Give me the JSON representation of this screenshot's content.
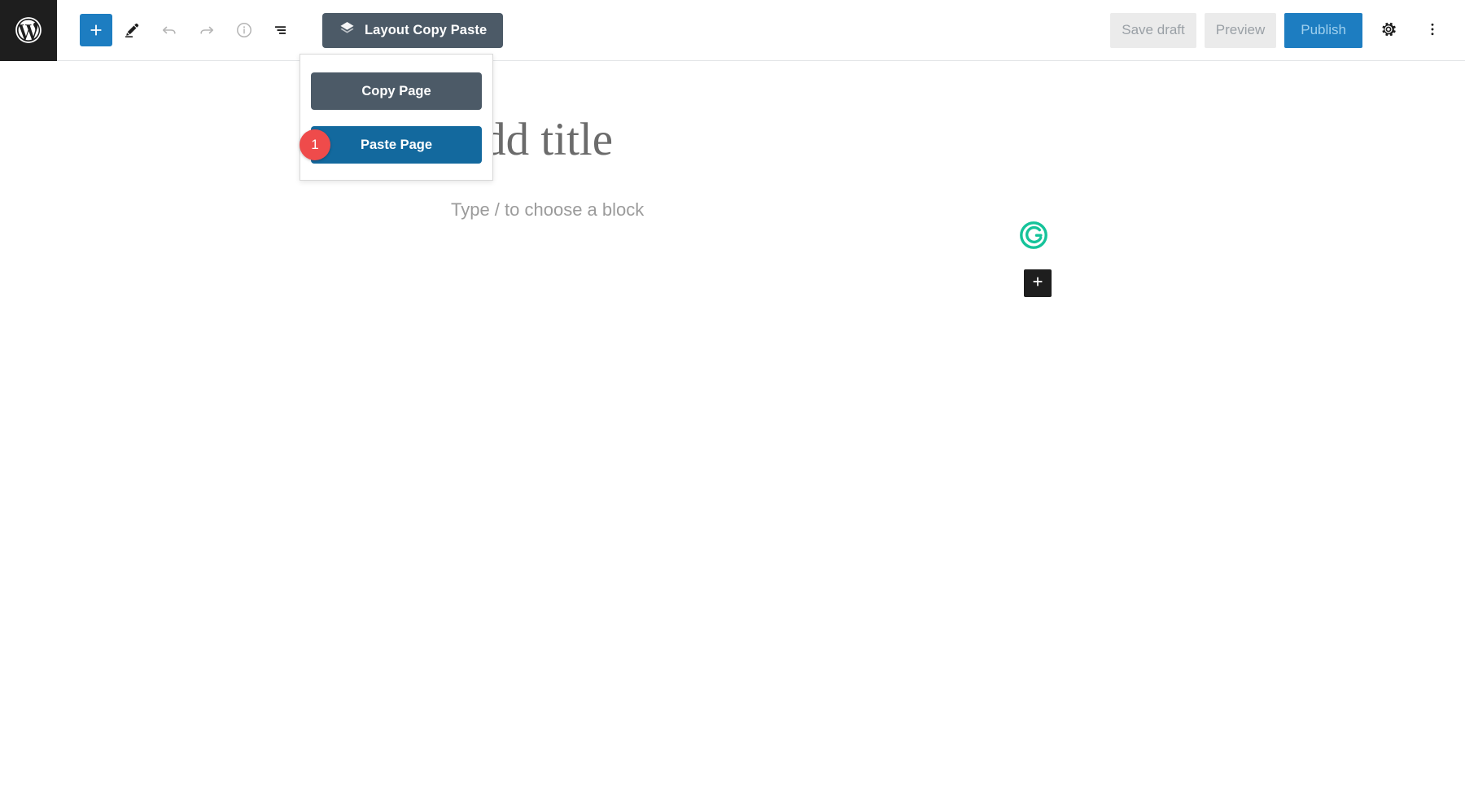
{
  "header": {
    "logo_icon": "wordpress-logo-icon",
    "tools": [
      {
        "name": "add-block-button",
        "icon": "plus-icon",
        "label": "Add block",
        "state": "active"
      },
      {
        "name": "tools-button",
        "icon": "pencil-icon",
        "label": "Tools",
        "state": "enabled"
      },
      {
        "name": "undo-button",
        "icon": "undo-arrow-icon",
        "label": "Undo",
        "state": "disabled"
      },
      {
        "name": "redo-button",
        "icon": "redo-arrow-icon",
        "label": "Redo",
        "state": "disabled"
      },
      {
        "name": "details-button",
        "icon": "info-circle-icon",
        "label": "Details",
        "state": "disabled"
      },
      {
        "name": "list-view-button",
        "icon": "list-view-icon",
        "label": "List view",
        "state": "enabled"
      }
    ],
    "plugin_button": {
      "label": "Layout Copy Paste",
      "icon": "layers-diamond-icon"
    },
    "actions": {
      "save_draft_label": "Save draft",
      "preview_label": "Preview",
      "publish_label": "Publish",
      "settings_icon": "gear-icon",
      "more_options_icon": "three-dots-vertical-icon"
    }
  },
  "dropdown": {
    "visible": true,
    "copy_label": "Copy Page",
    "paste_label": "Paste Page",
    "paste_badge_count": "1"
  },
  "editor": {
    "title_placeholder": "Add title",
    "block_placeholder": "Type / to choose a block",
    "grammarly_icon": "grammarly-g-icon",
    "inserter_icon": "plus-icon"
  },
  "colors": {
    "wp_admin_dark": "#1e1e1e",
    "accent_blue": "#1d7dc1",
    "paste_blue": "#13699e",
    "slate": "#4c5a67",
    "badge_red": "#ef4b4b",
    "grammarly_green": "#15c39a",
    "ghost_button_bg": "#ebebeb",
    "muted_text": "#9aa0a6"
  }
}
